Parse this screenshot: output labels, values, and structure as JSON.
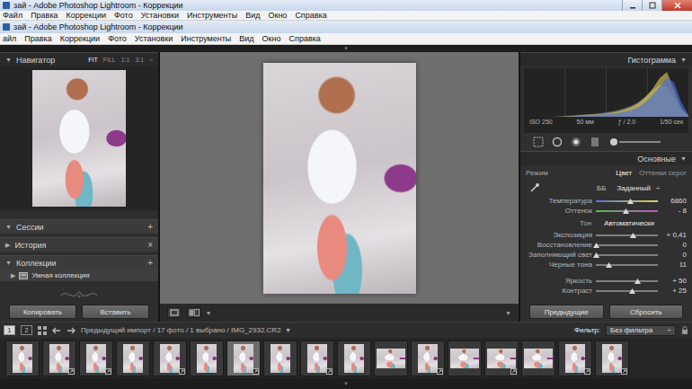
{
  "windows": [
    {
      "title": "зай - Adobe Photoshop Lightroom - Коррекции",
      "menu": [
        "Файл",
        "Правка",
        "Коррекции",
        "Фото",
        "Установки",
        "Инструменты",
        "Вид",
        "Окно",
        "Справка"
      ]
    },
    {
      "title": "зай - Adobe Photoshop Lightroom - Коррекции",
      "menu": [
        "айл",
        "Правка",
        "Коррекции",
        "Фото",
        "Установки",
        "Инструменты",
        "Вид",
        "Окно",
        "Справка"
      ]
    }
  ],
  "glyphs": {
    "expanded": "▼",
    "collapsed": "▶",
    "top_toggle": "▼",
    "bottom_toggle": "▼"
  },
  "left_panel": {
    "navigator": {
      "title": "Навигатор",
      "expanded": true,
      "zoom": [
        {
          "label": "FIT",
          "selected": true
        },
        {
          "label": "FILL",
          "selected": false
        },
        {
          "label": "1:1",
          "selected": false
        },
        {
          "label": "3:1",
          "selected": false
        }
      ],
      "zoom_arrow": "÷"
    },
    "sections": [
      {
        "title": "Сессии",
        "expanded": true,
        "action": "+"
      },
      {
        "title": "История",
        "expanded": false,
        "action": "×"
      },
      {
        "title": "Коллекции",
        "expanded": true,
        "action": "+"
      }
    ],
    "collections": [
      {
        "label": "Умная коллекция",
        "expanded": false
      }
    ],
    "buttons": [
      "Копировать",
      "Вставить"
    ]
  },
  "center_toolbar": {
    "dropdown": "▾",
    "collapse": "▼"
  },
  "right_panel": {
    "histogram": {
      "title": "Гистограмма",
      "expanded": true,
      "series": [
        {
          "name": "all",
          "color": "#9a9a9a",
          "values": [
            0,
            0,
            0,
            0,
            0,
            0.01,
            0.02,
            0.03,
            0.04,
            0.05,
            0.06,
            0.08,
            0.1,
            0.13,
            0.17,
            0.22,
            0.3,
            0.42,
            0.55,
            0.66,
            0.62,
            0.4,
            0.15,
            0.02
          ]
        },
        {
          "name": "yellow",
          "color": "#d8c24a",
          "values": [
            0,
            0,
            0,
            0,
            0,
            0,
            0.01,
            0.02,
            0.03,
            0.04,
            0.05,
            0.06,
            0.08,
            0.1,
            0.14,
            0.2,
            0.28,
            0.4,
            0.58,
            0.8,
            0.92,
            0.55,
            0.18,
            0.02
          ]
        },
        {
          "name": "blue",
          "color": "#4a6fd8",
          "values": [
            0,
            0,
            0,
            0,
            0,
            0,
            0,
            0.01,
            0.02,
            0.03,
            0.04,
            0.05,
            0.06,
            0.08,
            0.1,
            0.14,
            0.2,
            0.3,
            0.45,
            0.62,
            0.82,
            0.7,
            0.3,
            0.04
          ]
        }
      ],
      "info": [
        "ISO 250",
        "50 мм",
        "ƒ / 2.0",
        "1/50 сек"
      ]
    },
    "basic": {
      "title": "Основные",
      "expanded": true,
      "mode": {
        "label": "Режим",
        "options": [
          {
            "label": "Цвет",
            "selected": true
          },
          {
            "label": "Оттенки серог",
            "selected": false
          }
        ]
      },
      "wb": {
        "label": "ББ",
        "value": "Заданный",
        "arrow": "÷"
      },
      "wb_sliders": [
        {
          "label": "Температура",
          "value": "6860",
          "level": 0.55,
          "kind": "temp"
        },
        {
          "label": "Оттенок",
          "value": "- 8",
          "level": 0.48,
          "kind": "tint"
        }
      ],
      "tone": {
        "label": "Тон",
        "auto": "Автоматически"
      },
      "tone_sliders": [
        {
          "label": "Экспозиция",
          "value": "+ 0,41",
          "level": 0.6,
          "kind": "plain"
        },
        {
          "label": "Восстановление",
          "value": "0",
          "level": 0.0,
          "kind": "plain"
        },
        {
          "label": "Заполняющий свет",
          "value": "0",
          "level": 0.0,
          "kind": "plain"
        },
        {
          "label": "Черные тона",
          "value": "11",
          "level": 0.2,
          "kind": "plain"
        }
      ],
      "presence_sliders": [
        {
          "label": "Яркость",
          "value": "+ 50",
          "level": 0.67,
          "kind": "plain"
        },
        {
          "label": "Контраст",
          "value": "+ 25",
          "level": 0.58,
          "kind": "plain"
        }
      ]
    },
    "buttons": [
      "Предыдущие",
      "Сбросить"
    ]
  },
  "filmstrip": {
    "screens": [
      {
        "label": "1",
        "selected": true
      },
      {
        "label": "2",
        "selected": false
      }
    ],
    "source": "Предыдущий импорт / 17 фото / 1 выбрано / IMG_2932.CR2",
    "source_arrow": "▾",
    "filter_label": "Фильтр:",
    "filter": "Без фильтра",
    "filter_arrow": "÷",
    "thumbs": [
      {
        "selected": false,
        "edited": false,
        "kind": "portrait"
      },
      {
        "selected": false,
        "edited": true,
        "kind": "portrait"
      },
      {
        "selected": false,
        "edited": true,
        "kind": "portrait"
      },
      {
        "selected": false,
        "edited": false,
        "kind": "portrait"
      },
      {
        "selected": false,
        "edited": true,
        "kind": "portrait"
      },
      {
        "selected": false,
        "edited": false,
        "kind": "portrait"
      },
      {
        "selected": true,
        "edited": true,
        "kind": "portrait"
      },
      {
        "selected": false,
        "edited": false,
        "kind": "portrait"
      },
      {
        "selected": false,
        "edited": true,
        "kind": "portrait"
      },
      {
        "selected": false,
        "edited": false,
        "kind": "portrait"
      },
      {
        "selected": false,
        "edited": false,
        "kind": "landscape"
      },
      {
        "selected": false,
        "edited": true,
        "kind": "portrait"
      },
      {
        "selected": false,
        "edited": false,
        "kind": "landscape"
      },
      {
        "selected": false,
        "edited": true,
        "kind": "landscape"
      },
      {
        "selected": false,
        "edited": false,
        "kind": "landscape"
      },
      {
        "selected": false,
        "edited": true,
        "kind": "portrait"
      },
      {
        "selected": false,
        "edited": true,
        "kind": "portrait"
      }
    ]
  }
}
